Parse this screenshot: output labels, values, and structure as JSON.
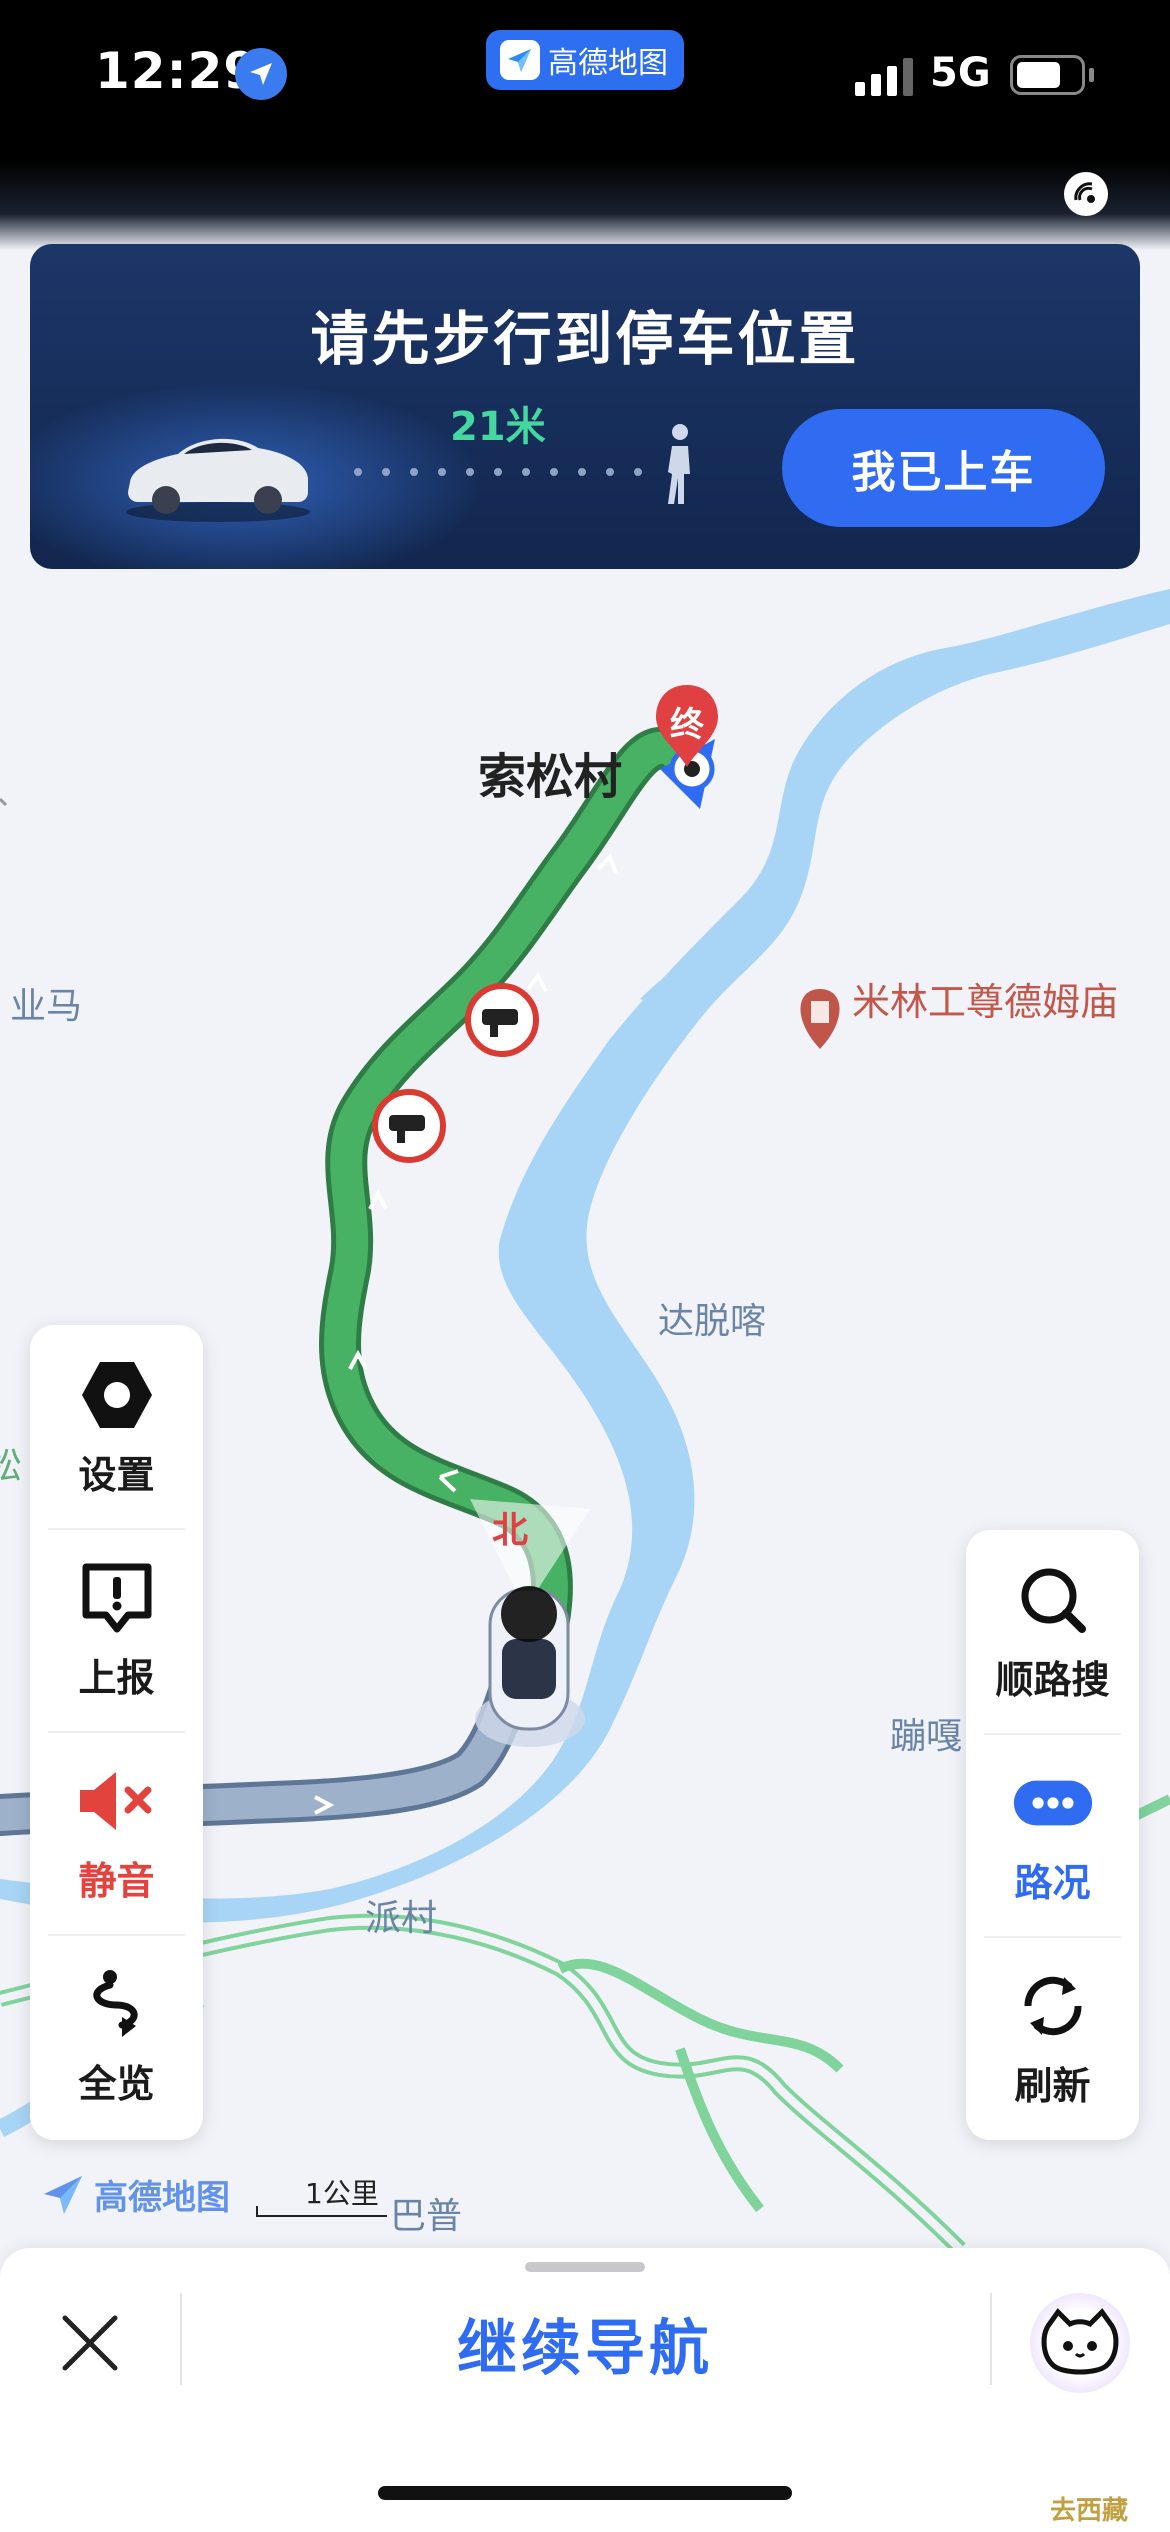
{
  "status_bar": {
    "time": "12:29",
    "app_badge": "高德地图",
    "network": "5G",
    "battery_level_fraction": 0.7
  },
  "banner": {
    "title": "请先步行到停车位置",
    "distance": "21米",
    "board_button": "我已上车"
  },
  "map": {
    "destination_marker": "终",
    "place_names": {
      "village": "索松村",
      "poi": "米林工尊德姆庙",
      "left_edge": "业马",
      "dashuoka": "达脱喀",
      "benga": "蹦嘎",
      "paicun": "派村",
      "bapu": "巴普",
      "left_cut": "松"
    },
    "compass_label": "北",
    "scale_label": "1公里",
    "brand": "高德地图",
    "colors": {
      "route": "#3fa95b",
      "passed_route": "#8ea4c2",
      "river": "#a8d4f5",
      "road_outline": "#7fd39b"
    }
  },
  "left_panel": {
    "items": [
      {
        "label": "设置",
        "icon": "settings-hexagon-icon"
      },
      {
        "label": "上报",
        "icon": "report-alert-icon"
      },
      {
        "label": "静音",
        "icon": "mute-speaker-icon"
      },
      {
        "label": "全览",
        "icon": "overview-route-icon"
      }
    ]
  },
  "right_panel": {
    "items": [
      {
        "label": "顺路搜",
        "icon": "search-icon"
      },
      {
        "label": "路况",
        "icon": "traffic-dots-icon"
      },
      {
        "label": "刷新",
        "icon": "refresh-icon"
      }
    ]
  },
  "bottom_sheet": {
    "continue_label": "继续导航",
    "close_icon": "close-icon",
    "assistant_icon": "assistant-cat-icon"
  },
  "watermark": "去西藏"
}
